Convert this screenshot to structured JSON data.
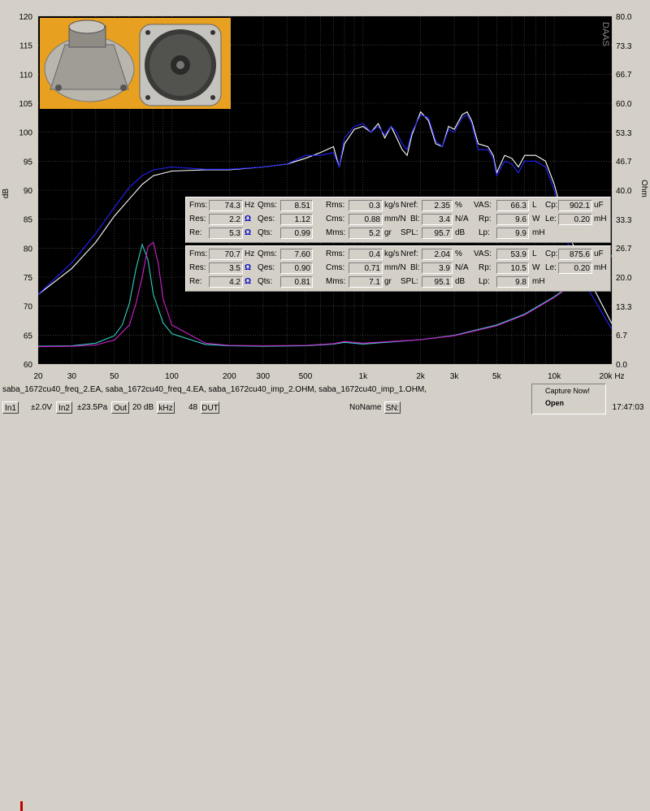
{
  "chart_data": {
    "type": "line",
    "watermark": "DAAS",
    "xscale": "log",
    "xlim": [
      20,
      20000
    ],
    "x_ticks": [
      {
        "v": 20,
        "label": "20"
      },
      {
        "v": 30,
        "label": "30"
      },
      {
        "v": 50,
        "label": "50"
      },
      {
        "v": 100,
        "label": "100"
      },
      {
        "v": 200,
        "label": "200"
      },
      {
        "v": 300,
        "label": "300"
      },
      {
        "v": 500,
        "label": "500"
      },
      {
        "v": 1000,
        "label": "1k"
      },
      {
        "v": 2000,
        "label": "2k"
      },
      {
        "v": 3000,
        "label": "3k"
      },
      {
        "v": 5000,
        "label": "5k"
      },
      {
        "v": 10000,
        "label": "10k"
      },
      {
        "v": 20000,
        "label": "20k Hz"
      }
    ],
    "ylabel_left": "dB",
    "ylim_left": [
      60,
      120
    ],
    "y_ticks_left": [
      "60",
      "65",
      "70",
      "75",
      "80",
      "85",
      "90",
      "95",
      "100",
      "105",
      "110",
      "115",
      "120"
    ],
    "ylabel_right": "Ohm",
    "ylim_right": [
      0,
      80
    ],
    "y_ticks_right": [
      "0.0",
      "6.7",
      "13.3",
      "20.0",
      "26.7",
      "33.3",
      "40.0",
      "46.7",
      "53.3",
      "60.0",
      "66.7",
      "73.3",
      "80.0"
    ],
    "grid": true,
    "series": [
      {
        "color": "#ffffff",
        "axis": "left",
        "points": [
          [
            20,
            72
          ],
          [
            30,
            76.5
          ],
          [
            40,
            81
          ],
          [
            50,
            85.5
          ],
          [
            60,
            88.5
          ],
          [
            70,
            91
          ],
          [
            80,
            92.5
          ],
          [
            100,
            93.3
          ],
          [
            150,
            93.5
          ],
          [
            200,
            93.5
          ],
          [
            300,
            94
          ],
          [
            400,
            94.5
          ],
          [
            500,
            95.5
          ],
          [
            600,
            96.5
          ],
          [
            700,
            97.5
          ],
          [
            750,
            94
          ],
          [
            800,
            98
          ],
          [
            900,
            100.5
          ],
          [
            1000,
            101
          ],
          [
            1100,
            100
          ],
          [
            1200,
            101.5
          ],
          [
            1300,
            99
          ],
          [
            1400,
            101
          ],
          [
            1500,
            99
          ],
          [
            1600,
            97
          ],
          [
            1700,
            96
          ],
          [
            1800,
            99.5
          ],
          [
            2000,
            103.5
          ],
          [
            2200,
            102
          ],
          [
            2400,
            98
          ],
          [
            2600,
            97.5
          ],
          [
            2800,
            101
          ],
          [
            3000,
            100.5
          ],
          [
            3300,
            103
          ],
          [
            3500,
            103.5
          ],
          [
            3700,
            102
          ],
          [
            4000,
            98
          ],
          [
            4500,
            97.5
          ],
          [
            4800,
            96
          ],
          [
            5000,
            93
          ],
          [
            5500,
            96
          ],
          [
            6000,
            95.5
          ],
          [
            6500,
            94
          ],
          [
            7000,
            96
          ],
          [
            8000,
            96
          ],
          [
            9000,
            95
          ],
          [
            10000,
            91
          ],
          [
            11000,
            86
          ],
          [
            12000,
            82
          ],
          [
            15000,
            75
          ],
          [
            20000,
            67
          ]
        ]
      },
      {
        "color": "#2222ff",
        "axis": "left",
        "points": [
          [
            20,
            72
          ],
          [
            30,
            77.5
          ],
          [
            40,
            82.5
          ],
          [
            50,
            87
          ],
          [
            60,
            90.5
          ],
          [
            70,
            92.5
          ],
          [
            80,
            93.5
          ],
          [
            100,
            94
          ],
          [
            150,
            93.6
          ],
          [
            200,
            93.6
          ],
          [
            300,
            94
          ],
          [
            400,
            94.5
          ],
          [
            500,
            96
          ],
          [
            600,
            96
          ],
          [
            700,
            96.5
          ],
          [
            750,
            94
          ],
          [
            800,
            99
          ],
          [
            900,
            101
          ],
          [
            1000,
            101.5
          ],
          [
            1100,
            100
          ],
          [
            1200,
            101
          ],
          [
            1300,
            99.5
          ],
          [
            1400,
            101
          ],
          [
            1500,
            100
          ],
          [
            1600,
            98
          ],
          [
            1700,
            97
          ],
          [
            1800,
            100
          ],
          [
            2000,
            103
          ],
          [
            2200,
            102.5
          ],
          [
            2400,
            98.5
          ],
          [
            2600,
            97.5
          ],
          [
            2800,
            100.5
          ],
          [
            3000,
            100
          ],
          [
            3300,
            102.5
          ],
          [
            3500,
            103
          ],
          [
            3700,
            101.5
          ],
          [
            4000,
            97
          ],
          [
            4500,
            97
          ],
          [
            4800,
            95.5
          ],
          [
            5000,
            92.5
          ],
          [
            5500,
            95
          ],
          [
            6000,
            94.5
          ],
          [
            6500,
            93
          ],
          [
            7000,
            95
          ],
          [
            8000,
            95
          ],
          [
            9000,
            94
          ],
          [
            10000,
            90
          ],
          [
            11000,
            84
          ],
          [
            12000,
            80
          ],
          [
            15000,
            73
          ],
          [
            20000,
            66
          ]
        ]
      },
      {
        "color": "#30d0c0",
        "axis": "right",
        "points": [
          [
            20,
            4.1
          ],
          [
            30,
            4.2
          ],
          [
            40,
            4.8
          ],
          [
            50,
            6.5
          ],
          [
            55,
            9
          ],
          [
            60,
            14
          ],
          [
            65,
            22
          ],
          [
            70,
            27.5
          ],
          [
            75,
            24
          ],
          [
            80,
            16
          ],
          [
            90,
            9.5
          ],
          [
            100,
            7
          ],
          [
            150,
            4.5
          ],
          [
            200,
            4.2
          ],
          [
            300,
            4.1
          ],
          [
            500,
            4.2
          ],
          [
            700,
            4.6
          ],
          [
            800,
            5
          ],
          [
            1000,
            4.6
          ],
          [
            2000,
            5.6
          ],
          [
            3000,
            6.6
          ],
          [
            5000,
            9
          ],
          [
            7000,
            11.5
          ],
          [
            10000,
            15.5
          ],
          [
            15000,
            21
          ],
          [
            20000,
            25
          ]
        ]
      },
      {
        "color": "#d020d0",
        "axis": "right",
        "points": [
          [
            20,
            4
          ],
          [
            30,
            4.1
          ],
          [
            40,
            4.4
          ],
          [
            50,
            5.5
          ],
          [
            60,
            9
          ],
          [
            65,
            14
          ],
          [
            70,
            20
          ],
          [
            75,
            27
          ],
          [
            80,
            28
          ],
          [
            85,
            23
          ],
          [
            90,
            15
          ],
          [
            100,
            9
          ],
          [
            150,
            4.8
          ],
          [
            200,
            4.3
          ],
          [
            300,
            4.2
          ],
          [
            500,
            4.3
          ],
          [
            700,
            4.7
          ],
          [
            800,
            5.2
          ],
          [
            1000,
            4.8
          ],
          [
            2000,
            5.6
          ],
          [
            3000,
            6.5
          ],
          [
            5000,
            8.8
          ],
          [
            7000,
            11.3
          ],
          [
            10000,
            15.3
          ],
          [
            15000,
            20.8
          ],
          [
            20000,
            24.8
          ]
        ]
      }
    ]
  },
  "panel1": {
    "fms": "74.3",
    "fms_u": "Hz",
    "qms": "8.51",
    "rms": "0.3",
    "rms_u": "kg/s",
    "nref": "2.35",
    "nref_u": "%",
    "vas": "66.3",
    "vas_u": "L",
    "cp": "902.1",
    "cp_u": "uF",
    "res": "2.2",
    "qes": "1.12",
    "cms": "0.88",
    "cms_u": "mm/N",
    "bl": "3.4",
    "bl_u": "N/A",
    "rp": "9.6",
    "rp_u": "W",
    "le": "0.20",
    "le_u": "mH",
    "re": "5.3",
    "qts": "0.99",
    "mms": "5.2",
    "mms_u": "gr",
    "spl": "95.7",
    "spl_u": "dB",
    "lp": "9.9",
    "lp_u": "mH"
  },
  "panel2": {
    "fms": "70.7",
    "fms_u": "Hz",
    "qms": "7.60",
    "rms": "0.4",
    "rms_u": "kg/s",
    "nref": "2.04",
    "nref_u": "%",
    "vas": "53.9",
    "vas_u": "L",
    "cp": "875.6",
    "cp_u": "uF",
    "res": "3.5",
    "qes": "0.90",
    "cms": "0.71",
    "cms_u": "mm/N",
    "bl": "3.9",
    "bl_u": "N/A",
    "rp": "10.5",
    "rp_u": "W",
    "le": "0.20",
    "le_u": "mH",
    "re": "4.2",
    "qts": "0.81",
    "mms": "7.1",
    "mms_u": "gr",
    "spl": "95.1",
    "spl_u": "dB",
    "lp": "9.8",
    "lp_u": "mH"
  },
  "labels": {
    "fms": "Fms:",
    "qms": "Qms:",
    "rms": "Rms:",
    "nref": "Nref:",
    "vas": "VAS:",
    "cp": "Cp:",
    "res": "Res:",
    "qes": "Qes:",
    "cms": "Cms:",
    "bl": "Bl:",
    "rp": "Rp:",
    "le": "Le:",
    "re": "Re:",
    "qts": "Qts:",
    "mms": "Mms:",
    "spl": "SPL:",
    "lp": "Lp:",
    "ohm": "Ω"
  },
  "files_text": "saba_1672cu40_freq_2.EA, saba_1672cu40_freq_4.EA, saba_1672cu40_imp_2.OHM, saba_1672cu40_imp_1.OHM,",
  "status": {
    "in1": "In1",
    "in1_level": "±2.0V",
    "in2": "In2",
    "in2_level": "±23.5Pa",
    "out": "Out",
    "out_level": "20 dB",
    "khz": "kHz",
    "dut_num": "48",
    "dut": "DUT",
    "name": "NoName",
    "sn": "SN:"
  },
  "capture": {
    "title": "Capture Now!",
    "open": "Open"
  },
  "clock": "17:47:03",
  "colors": {
    "background": "#000000",
    "grid": "#606060",
    "photo_bg": "#e8a020"
  }
}
